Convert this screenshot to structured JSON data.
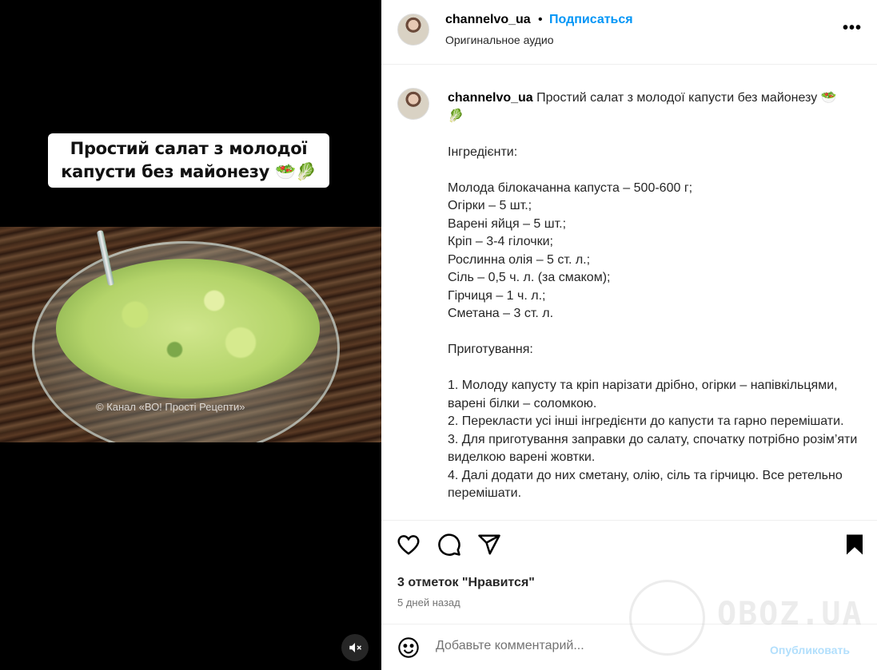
{
  "media": {
    "overlay_title_line1": "Простий салат з молодої",
    "overlay_title_line2": "капусти без майонезу 🥗🥬",
    "watermark": "© Канал «ВО! Прості Рецепти»",
    "mute_icon": "speaker-muted-icon"
  },
  "header": {
    "username": "channelvo_ua",
    "dot": "•",
    "follow": "Подписаться",
    "audio": "Оригинальное аудио",
    "more": "•••"
  },
  "post": {
    "username": "channelvo_ua",
    "text": " Простий салат з молодої капусти без майонезу 🥗\n🥬\n\nІнгредієнти:\n\nМолода білокачанна капуста – 500-600 г;\nОгірки – 5 шт.;\nВарені яйця – 5 шт.;\nКріп – 3-4 гілочки;\nРослинна олія – 5 ст. л.;\nСіль – 0,5 ч. л. (за смаком);\nГірчиця – 1 ч. л.;\nСметана – 3 ст. л.\n\nПриготування:\n\n1. Молоду капусту та кріп нарізати дрібно, огірки – напівкільцями, варені білки – соломкою.\n2. Перекласти усі інші інгредієнти до капусти та гарно перемішати.\n3. Для приготування заправки до салату, спочатку потрібно розім’яти виделкою варені жовтки.\n4. Далі додати до них сметану, олію, сіль та гірчицю. Все ретельно перемішати."
  },
  "actions": {
    "likes": "3 отметок \"Нравится\"",
    "time_ago": "5 дней назад"
  },
  "comment": {
    "placeholder": "Добавьте комментарий...",
    "publish": "Опубликовать"
  },
  "watermark": {
    "text": "OBOZ.UA"
  }
}
